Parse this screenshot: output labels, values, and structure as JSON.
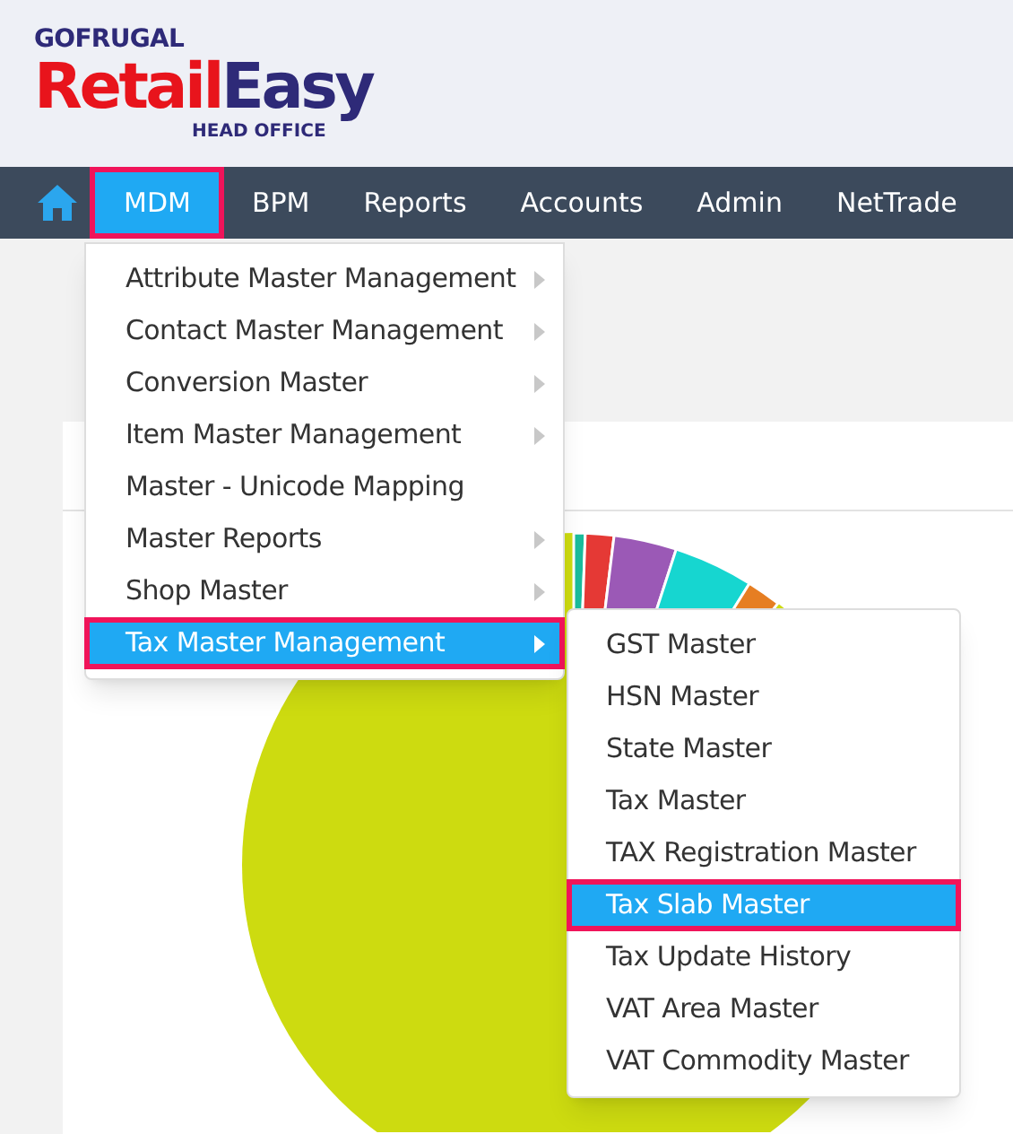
{
  "logo": {
    "company": "GOFRUGAL",
    "product_part_1": "Retail",
    "product_part_2": "Easy",
    "edition": "HEAD OFFICE"
  },
  "nav": [
    {
      "label": "MDM",
      "selected": true
    },
    {
      "label": "BPM",
      "selected": false
    },
    {
      "label": "Reports",
      "selected": false
    },
    {
      "label": "Accounts",
      "selected": false
    },
    {
      "label": "Admin",
      "selected": false
    },
    {
      "label": "NetTrade",
      "selected": false
    }
  ],
  "menu": [
    {
      "label": "Attribute Master Management",
      "has_submenu": true,
      "selected": false
    },
    {
      "label": "Contact Master Management",
      "has_submenu": true,
      "selected": false
    },
    {
      "label": "Conversion Master",
      "has_submenu": true,
      "selected": false
    },
    {
      "label": "Item Master Management",
      "has_submenu": true,
      "selected": false
    },
    {
      "label": "Master - Unicode Mapping",
      "has_submenu": false,
      "selected": false
    },
    {
      "label": "Master Reports",
      "has_submenu": true,
      "selected": false
    },
    {
      "label": "Shop Master",
      "has_submenu": true,
      "selected": false
    },
    {
      "label": "Tax Master Management",
      "has_submenu": true,
      "selected": true
    }
  ],
  "submenu": [
    {
      "label": "GST Master",
      "selected": false
    },
    {
      "label": "HSN Master",
      "selected": false
    },
    {
      "label": "State Master",
      "selected": false
    },
    {
      "label": "Tax Master",
      "selected": false
    },
    {
      "label": "TAX Registration Master",
      "selected": false
    },
    {
      "label": "Tax Slab Master",
      "selected": true
    },
    {
      "label": "Tax Update History",
      "selected": false
    },
    {
      "label": "VAT Area Master",
      "selected": false
    },
    {
      "label": "VAT Commodity Master",
      "selected": false
    }
  ]
}
